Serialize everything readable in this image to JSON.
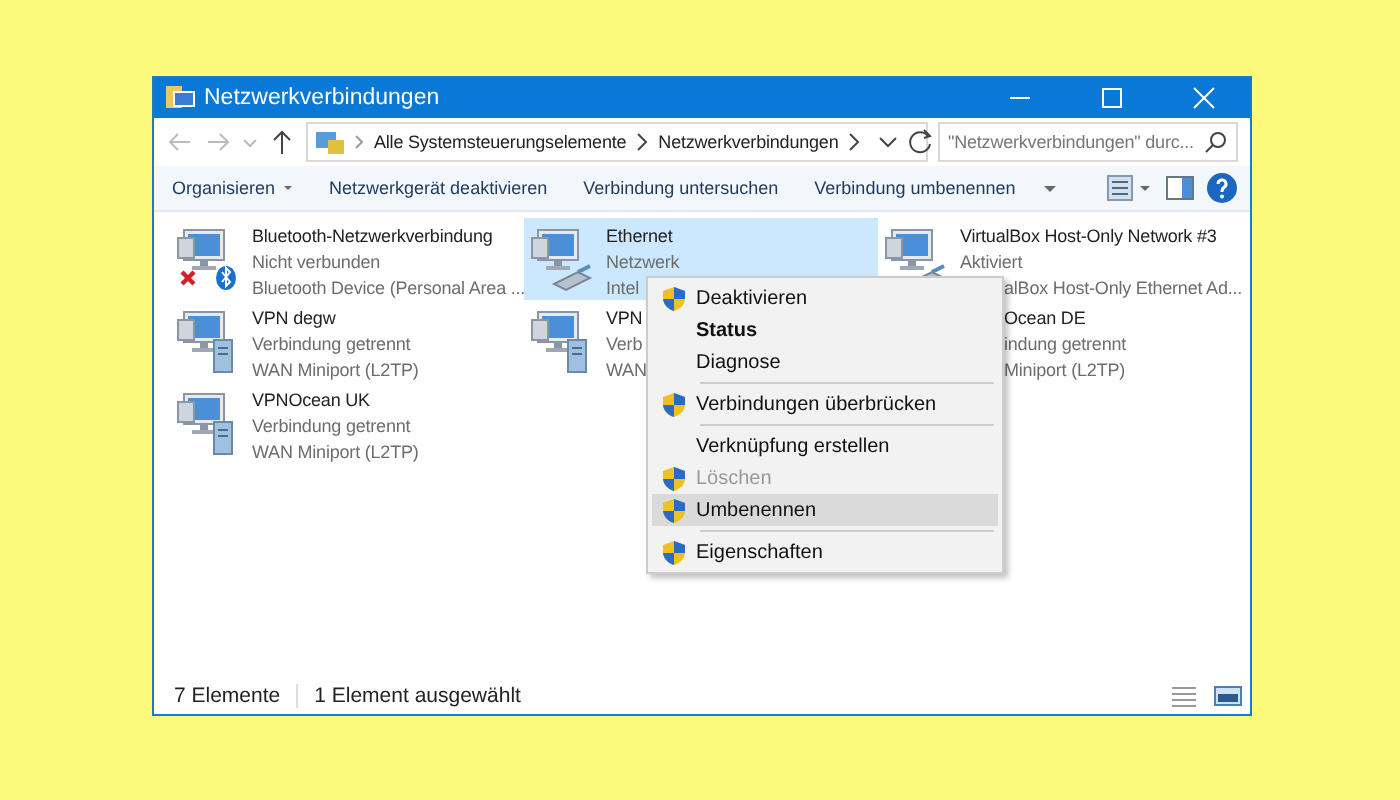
{
  "window": {
    "title": "Netzwerkverbindungen"
  },
  "address": {
    "crumbs": [
      "Alle Systemsteuerungselemente",
      "Netzwerkverbindungen"
    ],
    "search_placeholder": "\"Netzwerkverbindungen\" durc..."
  },
  "toolbar": [
    "Organisieren",
    "Netzwerkgerät deaktivieren",
    "Verbindung untersuchen",
    "Verbindung umbenennen"
  ],
  "items": [
    {
      "kind": "bluetooth",
      "selected": false,
      "lines": [
        {
          "text": "Bluetooth-Netzwerkverbindung",
          "cut": false
        },
        {
          "text": "Nicht verbunden",
          "cut": false
        },
        {
          "text": "Bluetooth Device (Personal Area ...",
          "cut": false
        }
      ]
    },
    {
      "kind": "ethernet",
      "selected": true,
      "lines": [
        {
          "text": "Ethernet",
          "cut": false
        },
        {
          "text": "Netzwerk",
          "cut": false
        },
        {
          "text": "Intel",
          "cut": false
        }
      ]
    },
    {
      "kind": "ethernet",
      "selected": false,
      "lines": [
        {
          "text": "VirtualBox Host-Only Network #3",
          "cut": false
        },
        {
          "text": "Aktiviert",
          "cut": false
        },
        {
          "text": "alBox Host-Only Ethernet Ad...",
          "cut": true
        }
      ]
    },
    {
      "kind": "vpn",
      "selected": false,
      "lines": [
        {
          "text": "VPN degw",
          "cut": false
        },
        {
          "text": "Verbindung getrennt",
          "cut": false
        },
        {
          "text": "WAN Miniport (L2TP)",
          "cut": false
        }
      ]
    },
    {
      "kind": "vpn",
      "selected": false,
      "lines": [
        {
          "text": "VPN",
          "cut": false
        },
        {
          "text": "Verb",
          "cut": false
        },
        {
          "text": "WAN",
          "cut": false
        }
      ]
    },
    {
      "kind": "covered",
      "selected": false,
      "lines": [
        {
          "text": "Ocean DE",
          "cut": true
        },
        {
          "text": "indung getrennt",
          "cut": true
        },
        {
          "text": "Miniport (L2TP)",
          "cut": true
        }
      ]
    },
    {
      "kind": "vpn",
      "selected": false,
      "lines": [
        {
          "text": "VPNOcean UK",
          "cut": false
        },
        {
          "text": "Verbindung getrennt",
          "cut": false
        },
        {
          "text": "WAN Miniport (L2TP)",
          "cut": false
        }
      ]
    }
  ],
  "context_menu": [
    {
      "kind": "item",
      "label": "Deaktivieren",
      "shield": true,
      "bold": false,
      "disabled": false,
      "selected": false
    },
    {
      "kind": "item",
      "label": "Status",
      "shield": false,
      "bold": true,
      "disabled": false,
      "selected": false
    },
    {
      "kind": "item",
      "label": "Diagnose",
      "shield": false,
      "bold": false,
      "disabled": false,
      "selected": false
    },
    {
      "kind": "separator"
    },
    {
      "kind": "item",
      "label": "Verbindungen überbrücken",
      "shield": true,
      "bold": false,
      "disabled": false,
      "selected": false
    },
    {
      "kind": "separator"
    },
    {
      "kind": "item",
      "label": "Verknüpfung erstellen",
      "shield": false,
      "bold": false,
      "disabled": false,
      "selected": false
    },
    {
      "kind": "item",
      "label": "Löschen",
      "shield": true,
      "bold": false,
      "disabled": true,
      "selected": false
    },
    {
      "kind": "item",
      "label": "Umbenennen",
      "shield": true,
      "bold": false,
      "disabled": false,
      "selected": true
    },
    {
      "kind": "separator"
    },
    {
      "kind": "item",
      "label": "Eigenschaften",
      "shield": true,
      "bold": false,
      "disabled": false,
      "selected": false
    }
  ],
  "status_bar": [
    "7 Elemente",
    "1 Element ausgewählt"
  ]
}
